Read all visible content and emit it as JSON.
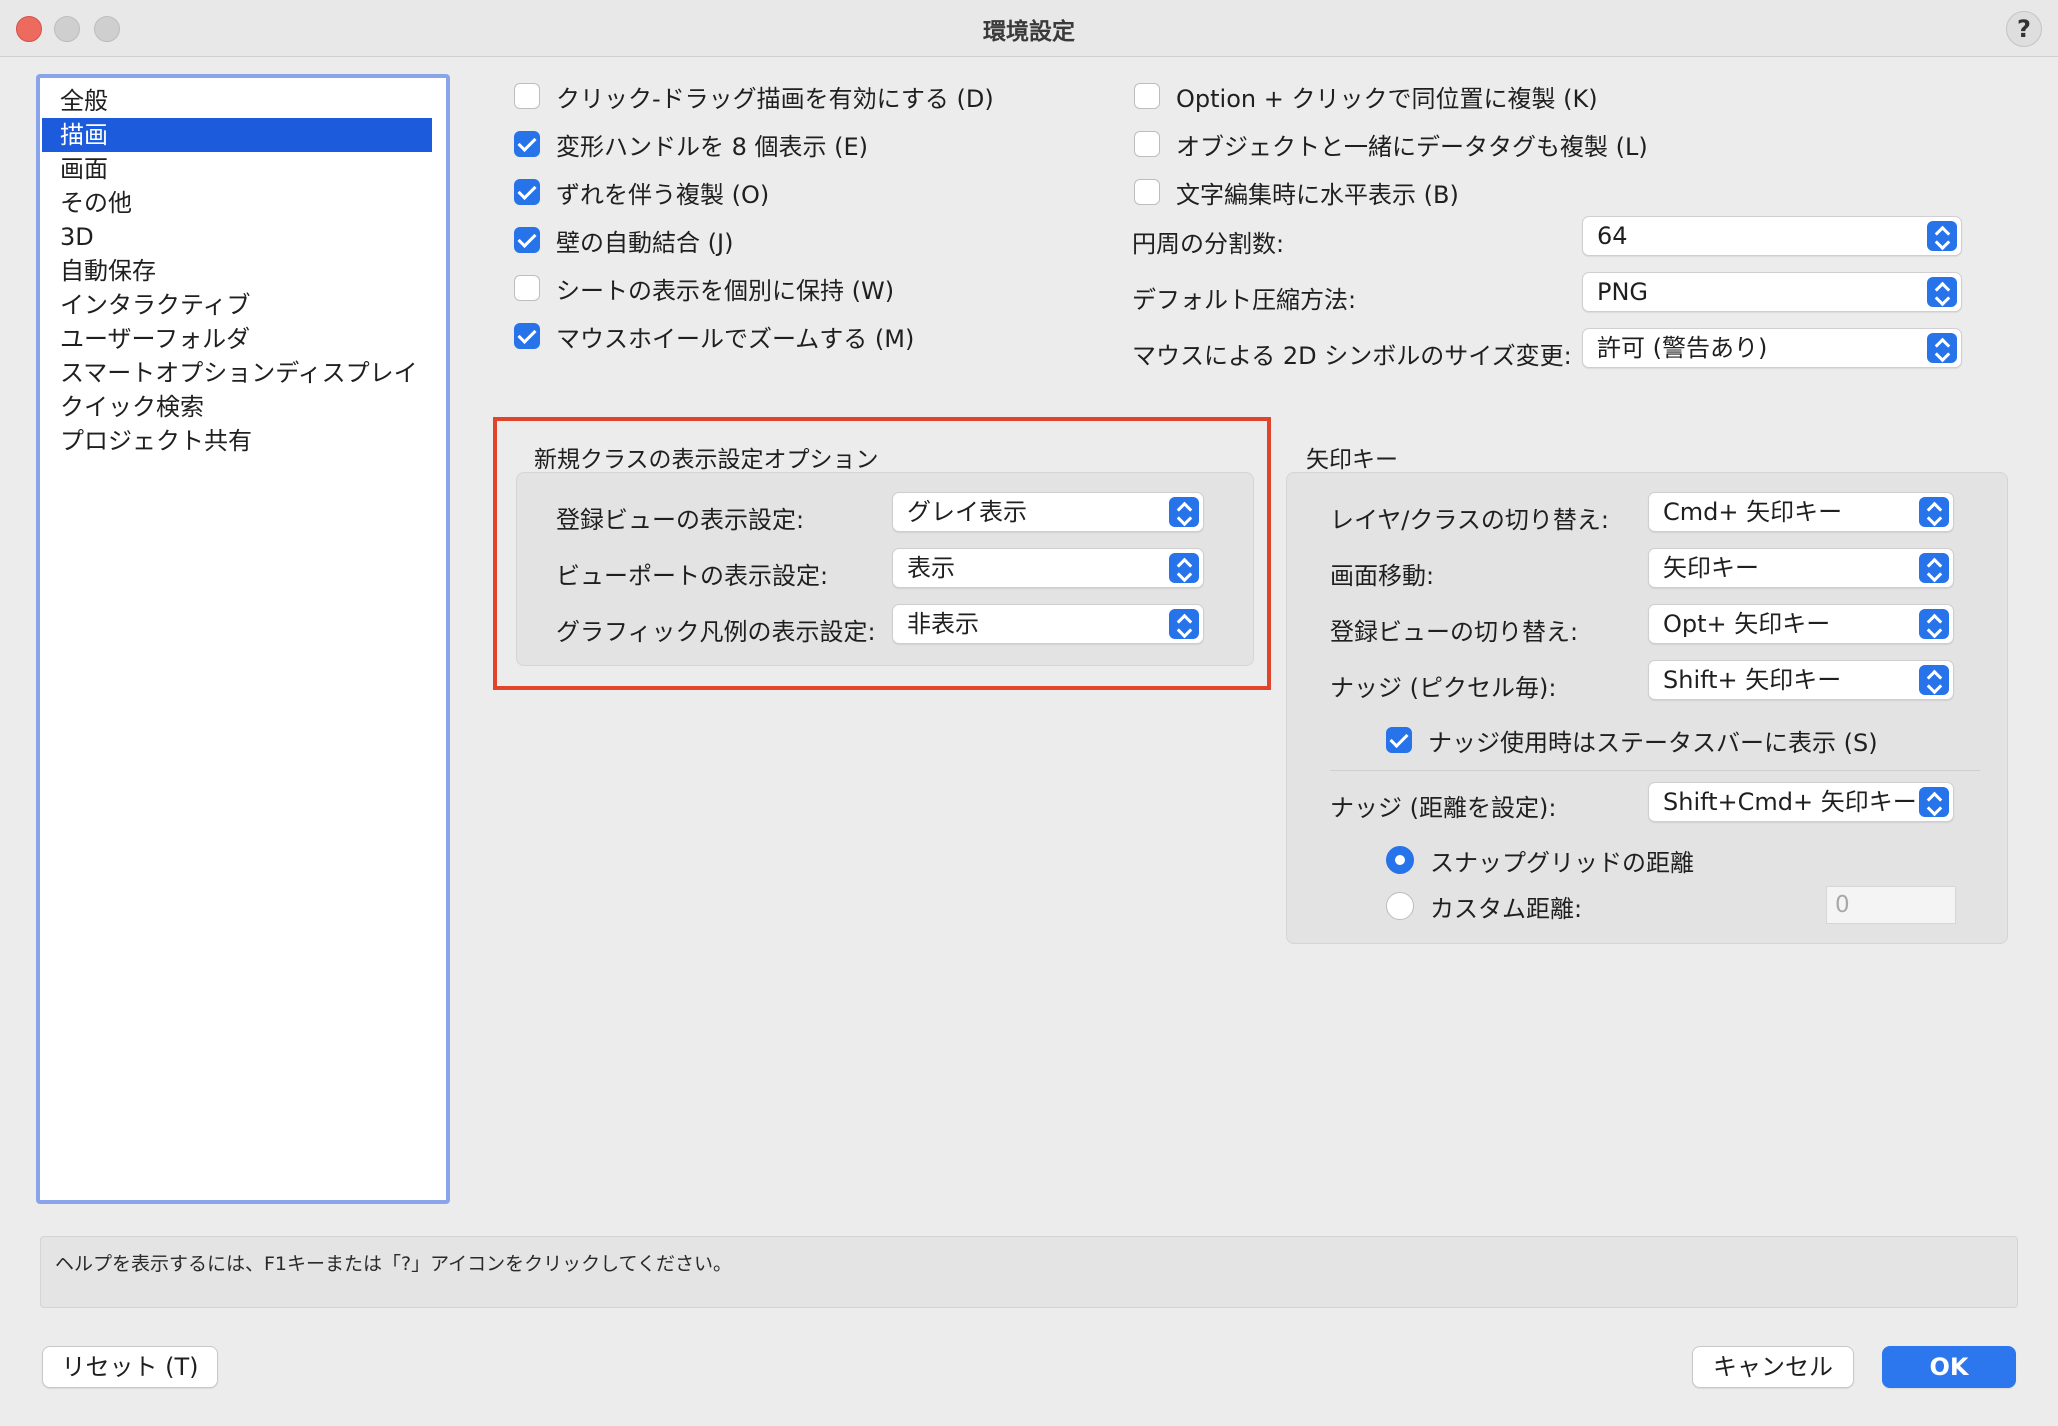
{
  "window": {
    "title": "環境設定",
    "help_icon": "?"
  },
  "categories": [
    "全般",
    "描画",
    "画面",
    "その他",
    "3D",
    "自動保存",
    "インタラクティブ",
    "ユーザーフォルダ",
    "スマートオプションディスプレイ",
    "クイック検索",
    "プロジェクト共有"
  ],
  "selected_category": "描画",
  "left_options": [
    {
      "label": "クリック-ドラッグ描画を有効にする (D)",
      "checked": false
    },
    {
      "label": "変形ハンドルを 8 個表示 (E)",
      "checked": true
    },
    {
      "label": "ずれを伴う複製 (O)",
      "checked": true
    },
    {
      "label": "壁の自動結合 (J)",
      "checked": true
    },
    {
      "label": "シートの表示を個別に保持 (W)",
      "checked": false
    },
    {
      "label": "マウスホイールでズームする (M)",
      "checked": true
    }
  ],
  "right_options": [
    {
      "label": "Option + クリックで同位置に複製 (K)",
      "checked": false
    },
    {
      "label": "オブジェクトと一緒にデータタグも複製 (L)",
      "checked": false
    },
    {
      "label": "文字編集時に水平表示 (B)",
      "checked": false
    }
  ],
  "right_popups": [
    {
      "label": "円周の分割数:",
      "value": "64"
    },
    {
      "label": "デフォルト圧縮方法:",
      "value": "PNG"
    },
    {
      "label": "マウスによる 2D シンボルのサイズ変更:",
      "value": "許可 (警告あり)"
    }
  ],
  "class_visibility": {
    "title": "新規クラスの表示設定オプション",
    "rows": [
      {
        "label": "登録ビューの表示設定:",
        "value": "グレイ表示"
      },
      {
        "label": "ビューポートの表示設定:",
        "value": "表示"
      },
      {
        "label": "グラフィック凡例の表示設定:",
        "value": "非表示"
      }
    ],
    "highlight_color": "#e0442d"
  },
  "arrow_keys": {
    "title": "矢印キー",
    "rows": [
      {
        "label": "レイヤ/クラスの切り替え:",
        "value": "Cmd+ 矢印キー"
      },
      {
        "label": "画面移動:",
        "value": "矢印キー"
      },
      {
        "label": "登録ビューの切り替え:",
        "value": "Opt+ 矢印キー"
      },
      {
        "label": "ナッジ (ピクセル毎):",
        "value": "Shift+ 矢印キー"
      }
    ],
    "status_bar_option": {
      "label": "ナッジ使用時はステータスバーに表示 (S)",
      "checked": true
    },
    "nudge_distance": {
      "label": "ナッジ (距離を設定):",
      "value": "Shift+Cmd+ 矢印キー"
    },
    "snap_grid_radio": {
      "label": "スナップグリッドの距離",
      "selected": true
    },
    "custom_radio": {
      "label": "カスタム距離:",
      "selected": false
    },
    "custom_value": "0"
  },
  "help_text": "ヘルプを表示するには、F1キーまたは「?」アイコンをクリックしてください。",
  "buttons": {
    "reset": "リセット (T)",
    "cancel": "キャンセル",
    "ok": "OK"
  },
  "accent_color": "#2673ea"
}
